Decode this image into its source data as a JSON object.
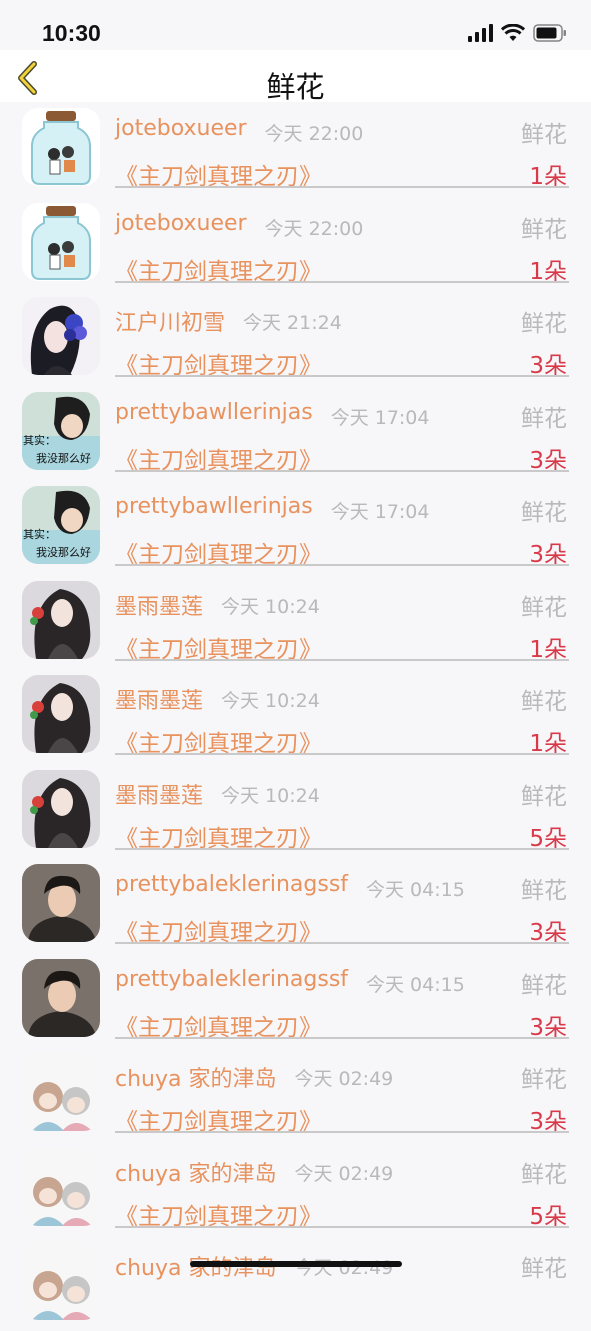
{
  "status_bar": {
    "time": "10:30"
  },
  "nav": {
    "title": "鲜花"
  },
  "rows": [
    {
      "name": "joteboxueer",
      "time": "今天 22:00",
      "type": "鲜花",
      "book": "《主刀剑真理之刃》",
      "count": "1朵",
      "avatar": "jar"
    },
    {
      "name": "joteboxueer",
      "time": "今天 22:00",
      "type": "鲜花",
      "book": "《主刀剑真理之刃》",
      "count": "1朵",
      "avatar": "jar"
    },
    {
      "name": "江户川初雪",
      "time": "今天 21:24",
      "type": "鲜花",
      "book": "《主刀剑真理之刃》",
      "count": "3朵",
      "avatar": "rose"
    },
    {
      "name": "prettybawllerinjas",
      "time": "今天 17:04",
      "type": "鲜花",
      "book": "《主刀剑真理之刃》",
      "count": "3朵",
      "avatar": "boy",
      "avatar_text": [
        "其实",
        "我没那么好"
      ]
    },
    {
      "name": "prettybawllerinjas",
      "time": "今天 17:04",
      "type": "鲜花",
      "book": "《主刀剑真理之刃》",
      "count": "3朵",
      "avatar": "boy",
      "avatar_text": [
        "其实",
        "我没那么好"
      ]
    },
    {
      "name": "墨雨墨莲",
      "time": "今天 10:24",
      "type": "鲜花",
      "book": "《主刀剑真理之刃》",
      "count": "1朵",
      "avatar": "girl"
    },
    {
      "name": "墨雨墨莲",
      "time": "今天 10:24",
      "type": "鲜花",
      "book": "《主刀剑真理之刃》",
      "count": "1朵",
      "avatar": "girl"
    },
    {
      "name": "墨雨墨莲",
      "time": "今天 10:24",
      "type": "鲜花",
      "book": "《主刀剑真理之刃》",
      "count": "5朵",
      "avatar": "girl"
    },
    {
      "name": "prettybaleklerinagssf",
      "time": "今天 04:15",
      "type": "鲜花",
      "book": "《主刀剑真理之刃》",
      "count": "3朵",
      "avatar": "man"
    },
    {
      "name": "prettybaleklerinagssf",
      "time": "今天 04:15",
      "type": "鲜花",
      "book": "《主刀剑真理之刃》",
      "count": "3朵",
      "avatar": "man"
    },
    {
      "name": "chuya 家的津岛",
      "time": "今天 02:49",
      "type": "鲜花",
      "book": "《主刀剑真理之刃》",
      "count": "3朵",
      "avatar": "anime"
    },
    {
      "name": "chuya 家的津岛",
      "time": "今天 02:49",
      "type": "鲜花",
      "book": "《主刀剑真理之刃》",
      "count": "5朵",
      "avatar": "anime"
    },
    {
      "name": "chuya 家的津岛",
      "time": "今天 02:49",
      "type": "鲜花",
      "book": "",
      "count": "",
      "avatar": "anime"
    }
  ]
}
